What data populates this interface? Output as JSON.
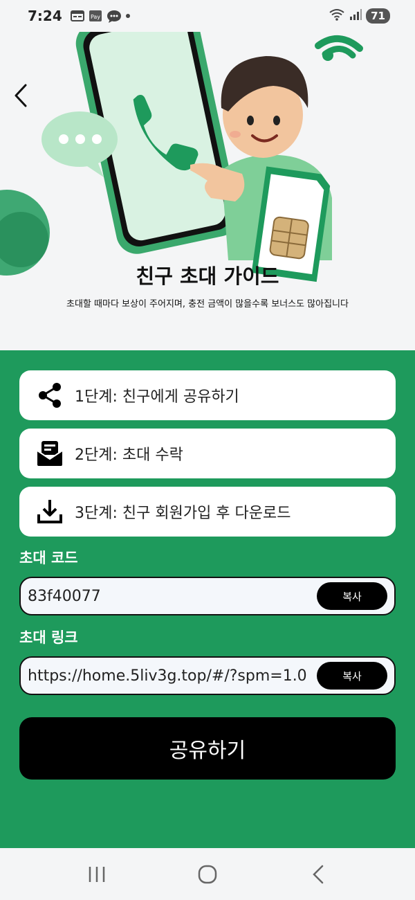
{
  "status_bar": {
    "time": "7:24",
    "battery": "71",
    "icons": [
      "calendar-icon",
      "pay-icon",
      "chat-icon",
      "dot-icon",
      "wifi-icon",
      "signal-icon"
    ]
  },
  "hero": {
    "title": "친구 초대 가이드",
    "subtitle": "초대할 때마다 보상이 주어지며, 충전 금액이 많을수록 보너스도 많아집니다"
  },
  "steps": [
    {
      "icon": "share-icon",
      "label": "1단계:  친구에게 공유하기"
    },
    {
      "icon": "mail-icon",
      "label": "2단계:  초대 수락"
    },
    {
      "icon": "download-icon",
      "label": "3단계:  친구 회원가입 후 다운로드"
    }
  ],
  "invite_code": {
    "label": "초대 코드",
    "value": "83f40077",
    "copy_label": "복사"
  },
  "invite_link": {
    "label": "초대 링크",
    "value": "https://home.5liv3g.top/#/?spm=1.0",
    "copy_label": "복사"
  },
  "share_button": "공유하기",
  "colors": {
    "primary_green": "#1e9a5c",
    "button_black": "#000000",
    "background_light": "#f4f5f6"
  },
  "nav": [
    "recents-icon",
    "home-icon",
    "back-nav-icon"
  ]
}
